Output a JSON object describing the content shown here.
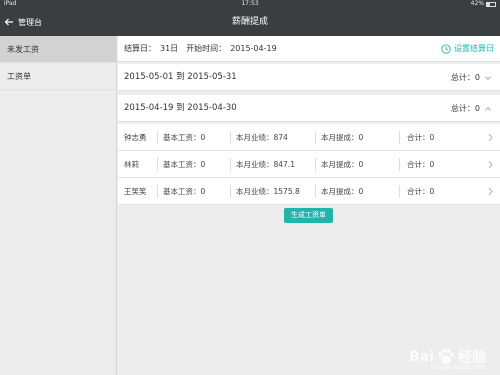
{
  "status_bar": {
    "device": "iPad",
    "time": "17:53",
    "battery": "42%"
  },
  "nav": {
    "back_label": "管理台",
    "title": "薪酬提成"
  },
  "sidebar": {
    "items": [
      {
        "label": "未发工资"
      },
      {
        "label": "工资单"
      }
    ]
  },
  "info": {
    "settle_day_label": "结算日：",
    "settle_day": "31日",
    "start_label": "开始时间：",
    "start_date": "2015-04-19",
    "settle_button": "设置结算日"
  },
  "periods": [
    {
      "range": "2015-05-01 到 2015-05-31",
      "total_label": "总计：",
      "total": "0"
    },
    {
      "range": "2015-04-19 到 2015-04-30",
      "total_label": "总计：",
      "total": "0"
    }
  ],
  "employees": [
    {
      "name": "钟志勇",
      "base": "基本工资：0",
      "perf": "本月业绩：874",
      "commission": "本月提成：0",
      "sum": "合计：0"
    },
    {
      "name": "林莉",
      "base": "基本工资：0",
      "perf": "本月业绩：847.1",
      "commission": "本月提成：0",
      "sum": "合计：0"
    },
    {
      "name": "王笑笑",
      "base": "基本工资：0",
      "perf": "本月业绩：1575.8",
      "commission": "本月提成：0",
      "sum": "合计：0"
    }
  ],
  "generate_button": "生成工资单",
  "watermark": {
    "brand": "Bai",
    "brand2": "经验",
    "sub": "jingyan.baidu.com"
  },
  "colors": {
    "accent": "#1fb5ad",
    "nav_bg": "#3b3d40"
  }
}
